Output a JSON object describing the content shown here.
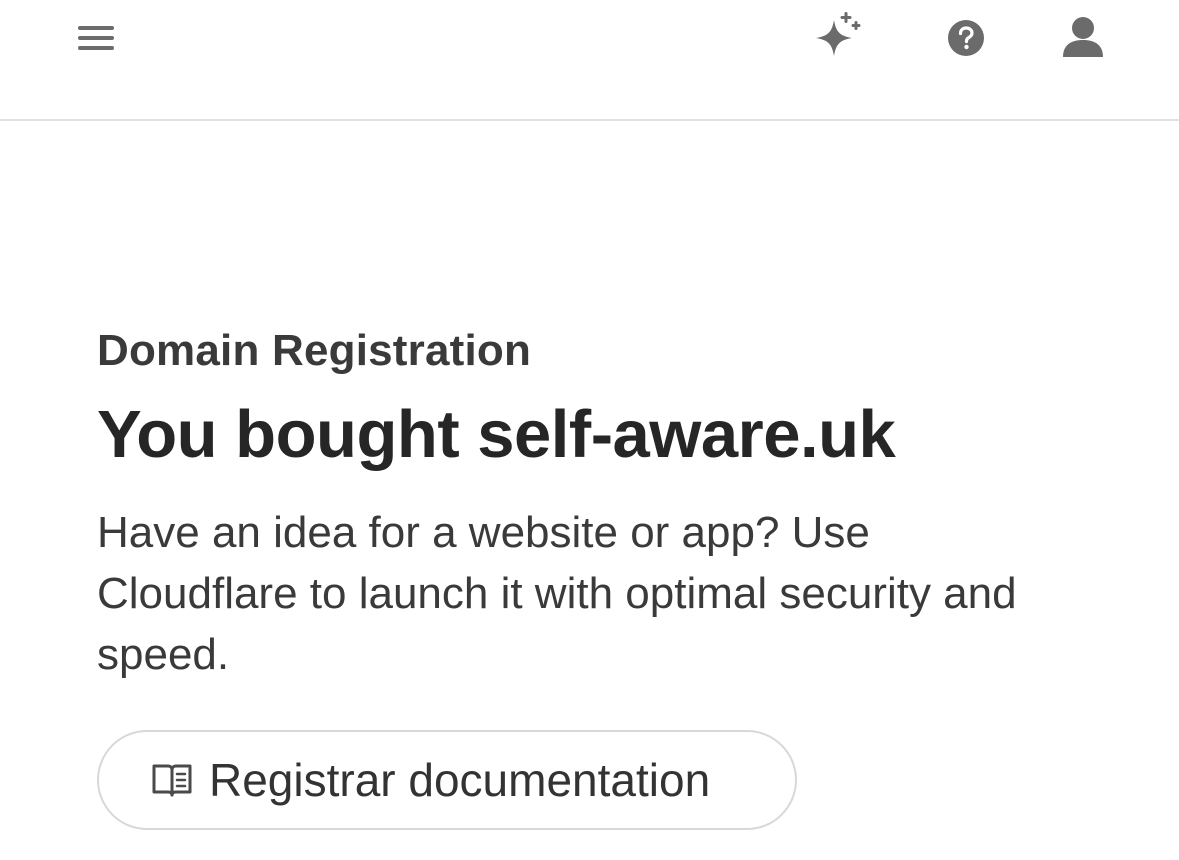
{
  "header": {
    "icons": {
      "menu": "hamburger-menu-icon",
      "ai": "sparkle-icon",
      "help": "question-mark-icon",
      "account": "user-icon"
    },
    "icon_color": "#6b6b6b"
  },
  "main": {
    "eyebrow": "Domain Registration",
    "title": "You bought self-aware.uk",
    "description": "Have an idea for a website or app? Use Cloudflare to launch it with optimal security and speed.",
    "doc_button": {
      "label": "Registrar documentation",
      "icon": "open-book-icon"
    }
  }
}
